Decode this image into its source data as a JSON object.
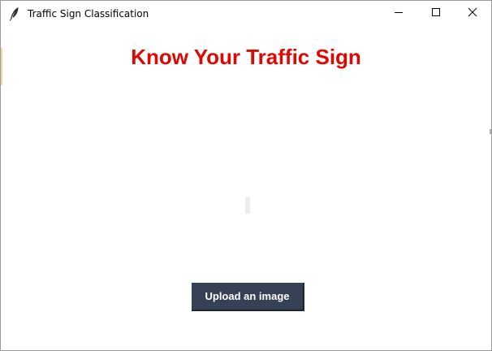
{
  "window": {
    "title": "Traffic Sign Classification",
    "icons": {
      "app": "feather-icon",
      "minimize": "minimize-icon",
      "maximize": "maximize-icon",
      "close": "close-icon"
    }
  },
  "main": {
    "heading": "Know Your Traffic Sign",
    "upload_button_label": "Upload an image"
  },
  "colors": {
    "heading": "#e10600",
    "button_bg": "#364156",
    "button_text": "#ffffff",
    "window_bg": "#ffffff"
  }
}
